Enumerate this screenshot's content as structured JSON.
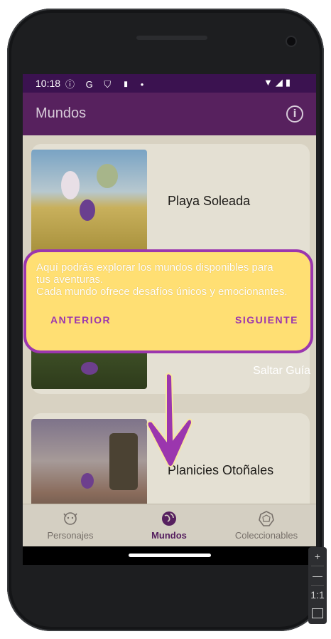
{
  "status_bar": {
    "time": "10:18",
    "left_icons": "ⓘ G ⛉ ▮ •",
    "right_icons": "▼◢▮"
  },
  "app_bar": {
    "title": "Mundos",
    "info_icon_glyph": "i"
  },
  "worlds": [
    {
      "name": "Playa Soleada"
    },
    {
      "name": ""
    },
    {
      "name": "Planicies Otoñales"
    }
  ],
  "guide": {
    "lines": [
      "Aquí podrás explorar los mundos disponibles para",
      "tus aventuras.",
      "Cada mundo ofrece desafíos únicos y emocionantes."
    ],
    "prev_label": "ANTERIOR",
    "next_label": "SIGUIENTE",
    "skip_label": "Saltar Guía"
  },
  "bottom_nav": [
    {
      "label": "Personajes",
      "icon": "character-icon",
      "active": false
    },
    {
      "label": "Mundos",
      "icon": "globe-icon",
      "active": true
    },
    {
      "label": "Coleccionables",
      "icon": "gem-icon",
      "active": false
    }
  ],
  "emulator_toolbar": {
    "zoom_in": "+",
    "zoom_out": "—",
    "ratio": "1:1"
  },
  "colors": {
    "status_bar": "#3b1250",
    "app_bar": "#57215e",
    "tooltip_bg": "#ffdf73",
    "tooltip_border": "#9b36ae",
    "accent": "#9b36ae"
  }
}
